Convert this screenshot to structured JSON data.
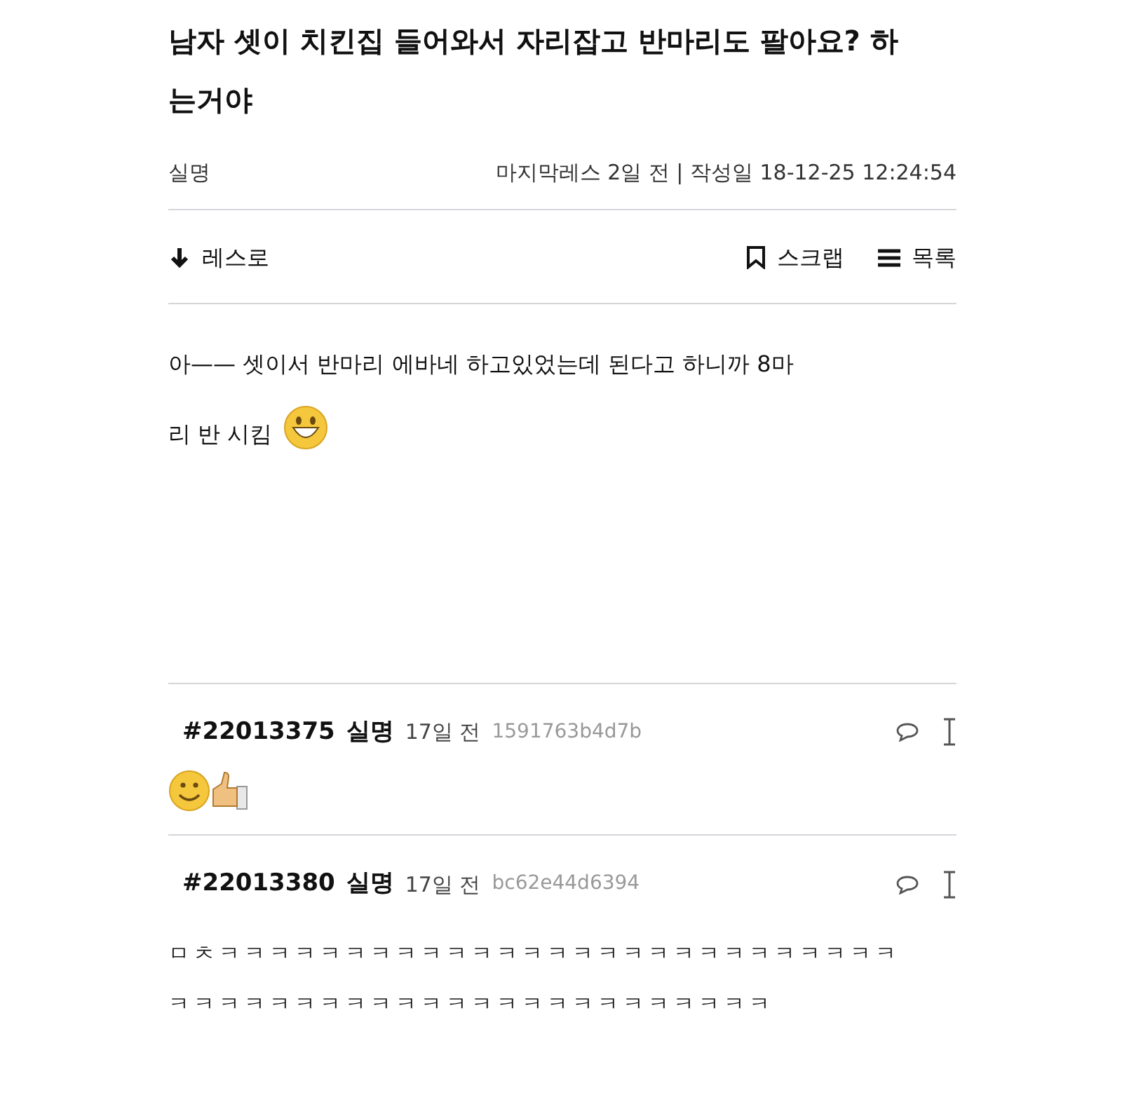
{
  "post": {
    "title_lines": [
      "남자 셋이 치킨집 들어와서 자리잡고 반마리도 팔아요? 하",
      "는거야"
    ],
    "author": "실명",
    "meta": "마지막레스 2일 전 | 작성일 18-12-25 12:24:54",
    "actions": [
      {
        "kind": "down",
        "label": "레스로"
      },
      {
        "kind": "scrap",
        "label": "스크랩"
      },
      {
        "kind": "list",
        "label": "목록"
      }
    ],
    "body_lines": [
      "아—— 셋이서 반마리 에바네 하고있었는데 된다고 하니까 8마",
      "리 반 시킴"
    ],
    "body_emojis": [
      {
        "kind": "grin"
      }
    ]
  },
  "comments": [
    {
      "number": "#22013375",
      "author": "실명",
      "time": "17일 전",
      "hash": "1591763b4d7b",
      "emojis": [
        {
          "kind": "smile"
        },
        {
          "kind": "thumbs-up"
        }
      ]
    },
    {
      "number": "#22013380",
      "author": "실명",
      "time": "17일 전",
      "hash": "bc62e44d6394",
      "lines": [
        "ㅁㅊㅋㅋㅋㅋㅋㅋㅋㅋㅋㅋㅋㅋㅋㅋㅋㅋㅋㅋㅋㅋㅋㅋㅋㅋㅋㅋㅋ",
        "ㅋㅋㅋㅋㅋㅋㅋㅋㅋㅋㅋㅋㅋㅋㅋㅋㅋㅋㅋㅋㅋㅋㅋㅋ"
      ]
    }
  ]
}
